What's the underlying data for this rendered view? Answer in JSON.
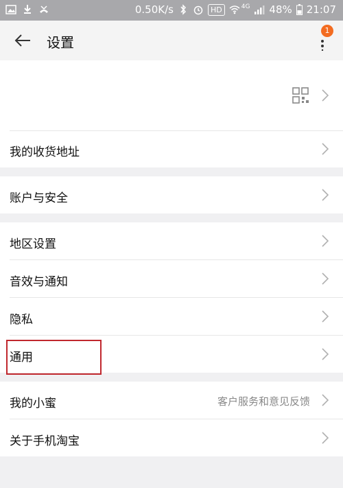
{
  "status_bar": {
    "speed": "0.50K/s",
    "hd": "HD",
    "network": "4G",
    "battery": "48%",
    "time": "21:07"
  },
  "header": {
    "title": "设置",
    "notification_count": "1"
  },
  "sections": [
    {
      "items": [
        {
          "label": "",
          "icon": "qr-code-icon"
        },
        {
          "label": "我的收货地址"
        }
      ]
    },
    {
      "items": [
        {
          "label": "账户与安全"
        }
      ]
    },
    {
      "items": [
        {
          "label": "地区设置"
        },
        {
          "label": "音效与通知"
        },
        {
          "label": "隐私"
        },
        {
          "label": "通用",
          "highlighted": true
        }
      ]
    },
    {
      "items": [
        {
          "label": "我的小蜜",
          "value": "客户服务和意见反馈"
        },
        {
          "label": "关于手机淘宝"
        }
      ]
    }
  ],
  "colors": {
    "accent": "#f36c21",
    "highlight_border": "#c0272d",
    "background": "#f0f0f2"
  }
}
